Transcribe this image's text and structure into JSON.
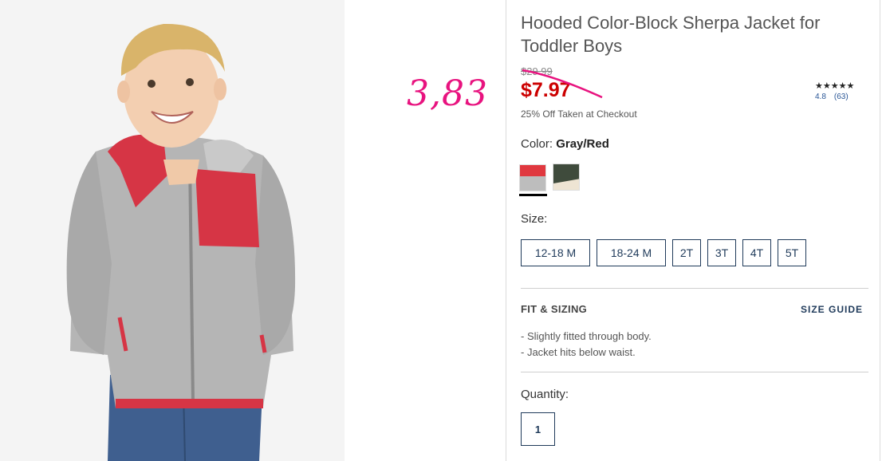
{
  "product": {
    "title": "Hooded Color-Block Sherpa Jacket for Toddler Boys",
    "original_price": "$29.99",
    "sale_price": "$7.97",
    "promo_text": "25% Off Taken at Checkout",
    "rating": {
      "stars": "★★★★★",
      "score": "4.8",
      "count": "(63)"
    }
  },
  "annotation": {
    "handwritten_price": "3,83",
    "color": "#e8137f"
  },
  "color_selector": {
    "label": "Color: ",
    "selected_value": "Gray/Red",
    "swatches": [
      {
        "name": "Gray/Red",
        "selected": true
      },
      {
        "name": "Olive/Cream",
        "selected": false
      }
    ]
  },
  "size_selector": {
    "label": "Size:",
    "options": [
      "12-18 M",
      "18-24 M",
      "2T",
      "3T",
      "4T",
      "5T"
    ]
  },
  "fit_sizing": {
    "heading": "FIT & SIZING",
    "guide_link": "SIZE GUIDE",
    "bullets": [
      "-  Slightly fitted through body.",
      "-  Jacket hits below waist."
    ]
  },
  "quantity": {
    "label": "Quantity:",
    "value": "1"
  },
  "colors": {
    "sale_red": "#cc0000",
    "navy": "#1f3a5a",
    "link_blue": "#2b5797"
  }
}
